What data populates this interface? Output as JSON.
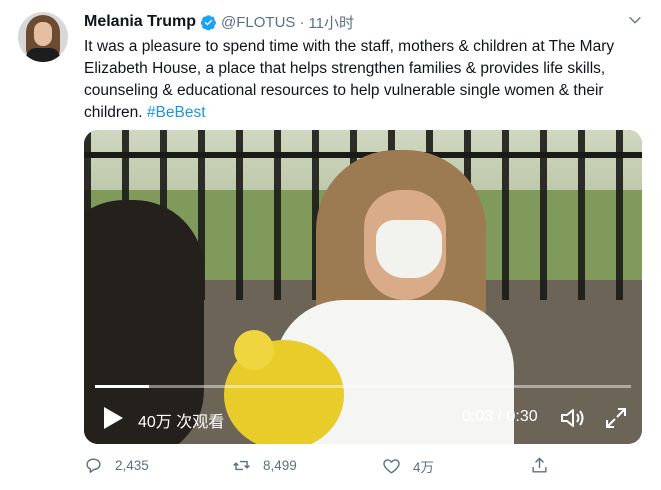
{
  "tweet": {
    "author_name": "Melania Trump",
    "handle": "@FLOTUS",
    "separator": "·",
    "time": "11小时",
    "text": "It was a pleasure to spend time with the staff, mothers & children at The Mary Elizabeth House, a place that helps strengthen families & provides life skills, counseling & educational resources to help vulnerable single women & their children.",
    "hashtag": "#BeBest"
  },
  "video": {
    "views": "40万 次观看",
    "time_display": "0:03 / 0:30",
    "progress": 0.1
  },
  "actions": {
    "replies": "2,435",
    "retweets": "8,499",
    "likes": "4万"
  },
  "colors": {
    "accent": "#1b95e0",
    "verified": "#1da1f2",
    "muted": "#5b7083"
  },
  "icons": [
    "verified-badge-icon",
    "chevron-down-icon",
    "play-icon",
    "volume-icon",
    "fullscreen-icon",
    "reply-icon",
    "retweet-icon",
    "like-icon",
    "share-icon"
  ]
}
